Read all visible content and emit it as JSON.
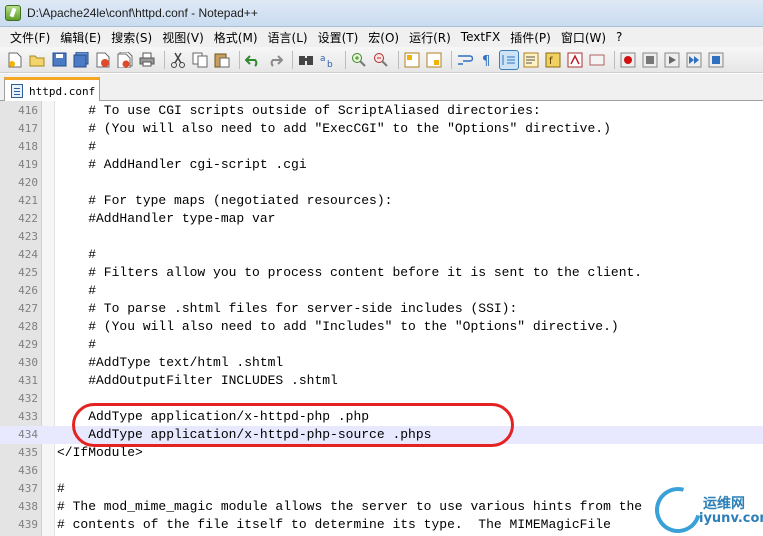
{
  "window": {
    "title": "D:\\Apache24le\\conf\\httpd.conf - Notepad++"
  },
  "menu": {
    "items": [
      "文件(F)",
      "编辑(E)",
      "搜索(S)",
      "视图(V)",
      "格式(M)",
      "语言(L)",
      "设置(T)",
      "宏(O)",
      "运行(R)",
      "TextFX",
      "插件(P)",
      "窗口(W)",
      "?"
    ]
  },
  "toolbar": {
    "icons": [
      "new-file-icon",
      "open-file-icon",
      "save-icon",
      "save-all-icon",
      "close-icon",
      "close-all-icon",
      "print-icon",
      "cut-icon",
      "copy-icon",
      "paste-icon",
      "undo-icon",
      "redo-icon",
      "find-icon",
      "replace-icon",
      "zoom-in-icon",
      "zoom-out-icon",
      "sync-v-icon",
      "sync-h-icon",
      "word-wrap-icon",
      "show-all-chars-icon",
      "indent-guide-icon",
      "doc-map-icon",
      "function-list-icon",
      "folder-workspace-icon",
      "monitoring-icon",
      "record-macro-icon",
      "stop-record-icon",
      "play-macro-icon",
      "run-macro-multiple-icon",
      "save-macro-icon"
    ]
  },
  "tab": {
    "label": "httpd.conf"
  },
  "editor": {
    "current_line": 434,
    "lines": [
      {
        "num": "416",
        "text": "    # To use CGI scripts outside of ScriptAliased directories:"
      },
      {
        "num": "417",
        "text": "    # (You will also need to add \"ExecCGI\" to the \"Options\" directive.)"
      },
      {
        "num": "418",
        "text": "    #"
      },
      {
        "num": "419",
        "text": "    # AddHandler cgi-script .cgi"
      },
      {
        "num": "420",
        "text": ""
      },
      {
        "num": "421",
        "text": "    # For type maps (negotiated resources):"
      },
      {
        "num": "422",
        "text": "    #AddHandler type-map var"
      },
      {
        "num": "423",
        "text": ""
      },
      {
        "num": "424",
        "text": "    #"
      },
      {
        "num": "425",
        "text": "    # Filters allow you to process content before it is sent to the client."
      },
      {
        "num": "426",
        "text": "    #"
      },
      {
        "num": "427",
        "text": "    # To parse .shtml files for server-side includes (SSI):"
      },
      {
        "num": "428",
        "text": "    # (You will also need to add \"Includes\" to the \"Options\" directive.)"
      },
      {
        "num": "429",
        "text": "    #"
      },
      {
        "num": "430",
        "text": "    #AddType text/html .shtml"
      },
      {
        "num": "431",
        "text": "    #AddOutputFilter INCLUDES .shtml"
      },
      {
        "num": "432",
        "text": ""
      },
      {
        "num": "433",
        "text": "    AddType application/x-httpd-php .php"
      },
      {
        "num": "434",
        "text": "    AddType application/x-httpd-php-source .phps"
      },
      {
        "num": "435",
        "text": "</IfModule>"
      },
      {
        "num": "436",
        "text": ""
      },
      {
        "num": "437",
        "text": "#"
      },
      {
        "num": "438",
        "text": "# The mod_mime_magic module allows the server to use various hints from the"
      },
      {
        "num": "439",
        "text": "# contents of the file itself to determine its type.  The MIMEMagicFile"
      }
    ]
  },
  "watermark": {
    "name": "运维网",
    "url": "iyunv.com"
  },
  "colors": {
    "annotation_oval": "#e52222",
    "current_line_bg": "#e8e8ff",
    "tab_accent": "#f5a623"
  }
}
